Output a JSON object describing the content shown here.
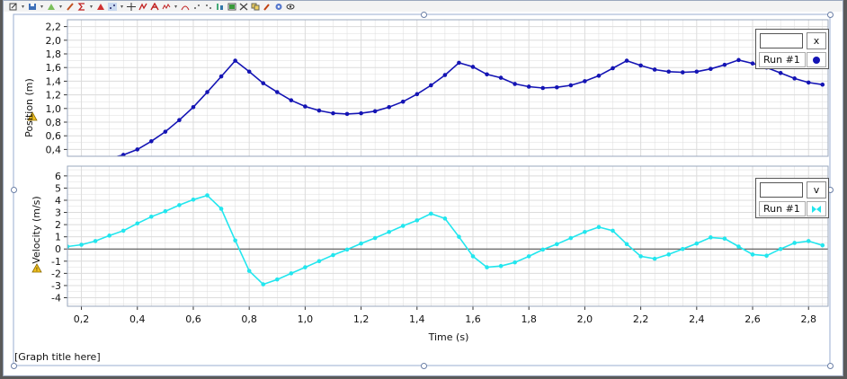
{
  "toolbar": {
    "icons": [
      "edit-icon",
      "save-icon",
      "shapes-icon",
      "brush-icon",
      "sigma-icon",
      "triangle-icon",
      "scatter-icon",
      "crosshair-icon",
      "fit-icon",
      "text-icon",
      "spline-icon",
      "peak-icon",
      "tangent-icon",
      "points-icon",
      "slope-icon",
      "integral-icon",
      "table-icon",
      "delete-icon",
      "copy-icon",
      "pin-icon",
      "gear-icon",
      "eye-icon"
    ]
  },
  "graph_title": "[Graph title here]",
  "colors": {
    "position_series": "#1414b4",
    "velocity_series": "#22e6ee",
    "grid": "#dcdcdc",
    "warning": "#f0c020"
  },
  "chart_data": [
    {
      "type": "line",
      "ylabel": "Position (m)",
      "y_ticks": [
        "2,2",
        "2,0",
        "1,8",
        "1,6",
        "1,4",
        "1,2",
        "1,0",
        "0,8",
        "0,6",
        "0,4"
      ],
      "ylim": [
        0.3,
        2.3
      ],
      "xlim": [
        0.15,
        2.87
      ],
      "legend": {
        "input_value": "",
        "button_label": "x",
        "run_label": "Run #1",
        "placement": "top-right"
      },
      "series": [
        {
          "name": "Run #1",
          "x": [
            0.15,
            0.2,
            0.25,
            0.3,
            0.35,
            0.4,
            0.45,
            0.5,
            0.55,
            0.6,
            0.65,
            0.7,
            0.75,
            0.8,
            0.85,
            0.9,
            0.95,
            1.0,
            1.05,
            1.1,
            1.15,
            1.2,
            1.25,
            1.3,
            1.35,
            1.4,
            1.45,
            1.5,
            1.55,
            1.6,
            1.65,
            1.7,
            1.75,
            1.8,
            1.85,
            1.9,
            1.95,
            2.0,
            2.05,
            2.1,
            2.15,
            2.2,
            2.25,
            2.3,
            2.35,
            2.4,
            2.45,
            2.5,
            2.55,
            2.6,
            2.65,
            2.7,
            2.75,
            2.8,
            2.85
          ],
          "values": [
            0.11,
            0.16,
            0.21,
            0.27,
            0.32,
            0.4,
            0.52,
            0.66,
            0.83,
            1.02,
            1.24,
            1.47,
            1.7,
            1.54,
            1.37,
            1.24,
            1.12,
            1.03,
            0.97,
            0.93,
            0.92,
            0.93,
            0.96,
            1.02,
            1.1,
            1.21,
            1.34,
            1.49,
            1.67,
            1.61,
            1.5,
            1.45,
            1.36,
            1.32,
            1.3,
            1.31,
            1.34,
            1.4,
            1.48,
            1.59,
            1.7,
            1.63,
            1.57,
            1.54,
            1.53,
            1.54,
            1.58,
            1.64,
            1.71,
            1.66,
            1.6,
            1.52,
            1.44,
            1.38,
            1.35
          ]
        }
      ]
    },
    {
      "type": "line",
      "xlabel": "Time (s)",
      "ylabel": "Velocity (m/s)",
      "x_ticks": [
        "0,2",
        "0,4",
        "0,6",
        "0,8",
        "1,0",
        "1,2",
        "1,4",
        "1,6",
        "1,8",
        "2,0",
        "2,2",
        "2,4",
        "2,6",
        "2,8"
      ],
      "y_ticks": [
        "6",
        "5",
        "4",
        "3",
        "2",
        "1",
        "0",
        "-1",
        "-2",
        "-3",
        "-4"
      ],
      "ylim": [
        -4.7,
        6.8
      ],
      "xlim": [
        0.15,
        2.87
      ],
      "legend": {
        "input_value": "",
        "button_label": "v",
        "run_label": "Run #1",
        "placement": "top-right"
      },
      "series": [
        {
          "name": "Run #1",
          "x": [
            0.15,
            0.2,
            0.25,
            0.3,
            0.35,
            0.4,
            0.45,
            0.5,
            0.55,
            0.6,
            0.65,
            0.7,
            0.75,
            0.8,
            0.85,
            0.9,
            0.95,
            1.0,
            1.05,
            1.1,
            1.15,
            1.2,
            1.25,
            1.3,
            1.35,
            1.4,
            1.45,
            1.5,
            1.55,
            1.6,
            1.65,
            1.7,
            1.75,
            1.8,
            1.85,
            1.9,
            1.95,
            2.0,
            2.05,
            2.1,
            2.15,
            2.2,
            2.25,
            2.3,
            2.35,
            2.4,
            2.45,
            2.5,
            2.55,
            2.6,
            2.65,
            2.7,
            2.75,
            2.8,
            2.85
          ],
          "values": [
            0.2,
            0.35,
            0.65,
            1.1,
            1.5,
            2.1,
            2.65,
            3.1,
            3.6,
            4.05,
            4.4,
            3.3,
            0.7,
            -1.8,
            -2.9,
            -2.5,
            -2.0,
            -1.5,
            -1.0,
            -0.5,
            -0.05,
            0.45,
            0.9,
            1.4,
            1.9,
            2.35,
            2.9,
            2.5,
            1.0,
            -0.6,
            -1.5,
            -1.4,
            -1.1,
            -0.6,
            -0.05,
            0.4,
            0.9,
            1.4,
            1.8,
            1.5,
            0.4,
            -0.6,
            -0.8,
            -0.45,
            0.0,
            0.45,
            0.95,
            0.85,
            0.2,
            -0.45,
            -0.55,
            0.0,
            0.5,
            0.65,
            0.3
          ]
        }
      ]
    }
  ]
}
